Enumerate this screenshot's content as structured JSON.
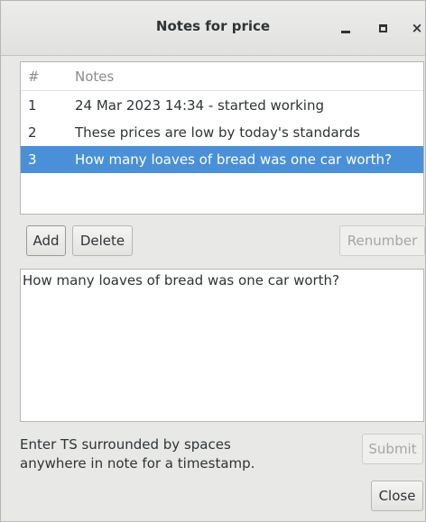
{
  "window": {
    "title": "Notes for price",
    "minimize_label": "_",
    "maximize_label": "□",
    "close_label": "×"
  },
  "notes_table": {
    "columns": [
      "#",
      "Notes"
    ],
    "rows": [
      {
        "num": "1",
        "note": "24 Mar 2023 14:34 - started working",
        "selected": false
      },
      {
        "num": "2",
        "note": "These prices are low by today's standards",
        "selected": false
      },
      {
        "num": "3",
        "note": "How many loaves of bread was one car worth?",
        "selected": true
      }
    ]
  },
  "buttons": {
    "add": "Add",
    "delete": "Delete",
    "renumber": "Renumber",
    "submit": "Submit",
    "close": "Close"
  },
  "editor": {
    "value": "How many loaves of bread was one car worth?"
  },
  "hint": {
    "line1": "Enter TS surrounded by spaces",
    "line2": "anywhere in note for a timestamp."
  },
  "colors": {
    "selection": "#4a90d9",
    "window_bg": "#e8e8e7"
  }
}
